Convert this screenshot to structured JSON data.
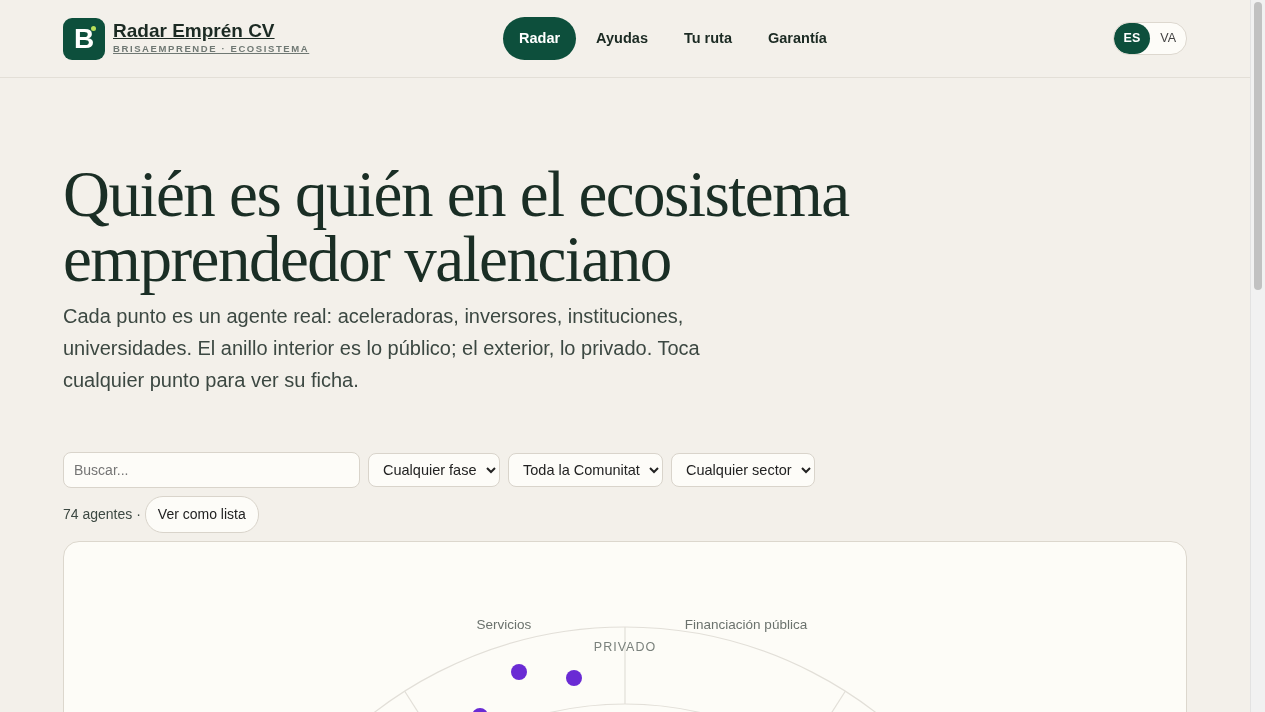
{
  "brand": {
    "logo_letter": "B",
    "title": "Radar Emprén CV",
    "subtitle": "BRISAEMPRENDE · ECOSISTEMA"
  },
  "nav": [
    {
      "label": "Radar",
      "selected": true
    },
    {
      "label": "Ayudas",
      "selected": false
    },
    {
      "label": "Tu ruta",
      "selected": false
    },
    {
      "label": "Garantía",
      "selected": false
    }
  ],
  "languages": [
    {
      "label": "ES",
      "selected": true
    },
    {
      "label": "VA",
      "selected": false
    }
  ],
  "hero": {
    "title_lines": [
      "Quién es quién en el ecosistema",
      "emprendedor valenciano"
    ],
    "lead": "Cada punto es un agente real: aceleradoras, inversores, instituciones, universidades. El anillo interior es lo público; el exterior, lo privado. Toca cualquier punto para ver su ficha."
  },
  "filters": {
    "search": {
      "placeholder": "Buscar..."
    },
    "selects": [
      {
        "value": "Cualquier fase"
      },
      {
        "value": "Toda la Comunitat"
      },
      {
        "value": "Cualquier sector"
      }
    ]
  },
  "summary": {
    "count": "74 agentes ·",
    "list_button": "Ver como lista"
  },
  "radar": {
    "sector_labels": [
      "Servicios",
      "Financiación pública"
    ],
    "ring_label": "PRIVADO"
  }
}
